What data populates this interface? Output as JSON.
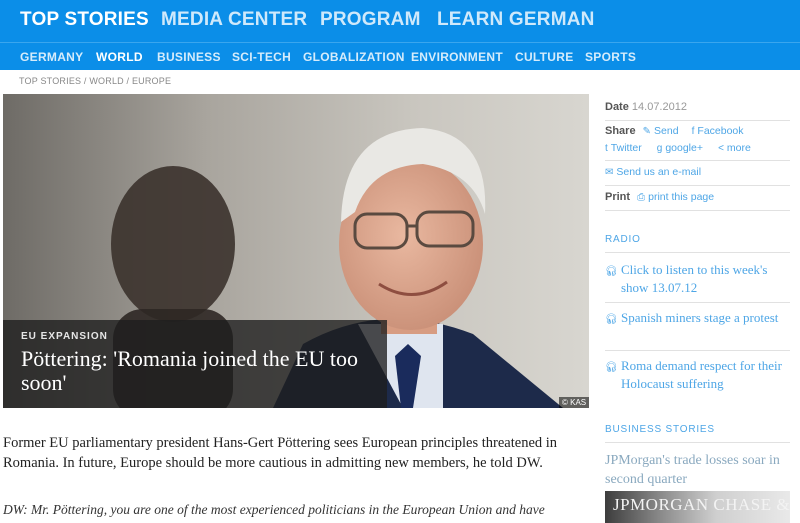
{
  "topnav": {
    "items": [
      {
        "label": "TOP STORIES"
      },
      {
        "label": "MEDIA CENTER"
      },
      {
        "label": "PROGRAM"
      },
      {
        "label": "LEARN GERMAN"
      }
    ]
  },
  "subnav": {
    "items": [
      {
        "label": "GERMANY"
      },
      {
        "label": "WORLD"
      },
      {
        "label": "BUSINESS"
      },
      {
        "label": "SCI-TECH"
      },
      {
        "label": "GLOBALIZATION"
      },
      {
        "label": "ENVIRONMENT"
      },
      {
        "label": "CULTURE"
      },
      {
        "label": "SPORTS"
      }
    ]
  },
  "breadcrumb": {
    "parts": [
      "TOP STORIES",
      "WORLD",
      "EUROPE"
    ],
    "sep": " / "
  },
  "article": {
    "kicker": "EU EXPANSION",
    "headline": "Pöttering: 'Romania joined the EU too soon'",
    "credit": "© KAS",
    "lead": "Former EU parliamentary president Hans-Gert Pöttering sees European principles threatened in Romania. In future, Europe should be more cautious in admitting new members, he told DW.",
    "question": "DW: Mr. Pöttering, you are one of the most experienced politicians in the European Union and have"
  },
  "sidebar": {
    "date_label": "Date",
    "date_value": "14.07.2012",
    "share_label": "Share",
    "share_links": {
      "send": "Send",
      "facebook": "Facebook",
      "twitter": "Twitter",
      "google": "google+",
      "more": "more"
    },
    "email_label": "Send us an e-mail",
    "print_label": "Print",
    "print_link": "print this page",
    "radio_title": "RADIO",
    "radio_items": [
      {
        "label": "Click to listen to this week's show 13.07.12"
      },
      {
        "label": "Spanish miners stage a protest"
      },
      {
        "label": "Roma demand respect for their Holocaust suffering"
      }
    ],
    "business_title": "BUSINESS STORIES",
    "business_items": [
      {
        "label": "JPMorgan's trade losses soar in second quarter"
      }
    ],
    "business_image_text": "JPMORGAN CHASE & CO."
  },
  "colors": {
    "nav_blue": "#0b8ee8",
    "link_blue": "#4ea6e6"
  }
}
